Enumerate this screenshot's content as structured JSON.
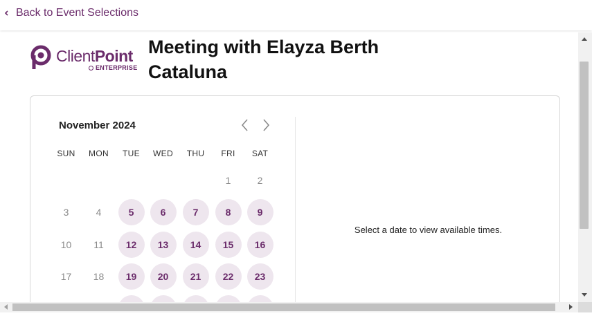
{
  "header": {
    "back_label": "Back to Event Selections"
  },
  "logo": {
    "brand_light": "Client",
    "brand_bold": "Point",
    "sub": "ENTERPRISE"
  },
  "event": {
    "title": "Meeting with Elayza Berth Cataluna"
  },
  "calendar": {
    "month_label": "November 2024",
    "weekdays": [
      "SUN",
      "MON",
      "TUE",
      "WED",
      "THU",
      "FRI",
      "SAT"
    ],
    "weeks": [
      [
        null,
        null,
        null,
        null,
        null,
        {
          "d": "1",
          "available": false
        },
        {
          "d": "2",
          "available": false
        }
      ],
      [
        {
          "d": "3",
          "available": false
        },
        {
          "d": "4",
          "available": false
        },
        {
          "d": "5",
          "available": true
        },
        {
          "d": "6",
          "available": true
        },
        {
          "d": "7",
          "available": true
        },
        {
          "d": "8",
          "available": true
        },
        {
          "d": "9",
          "available": true
        }
      ],
      [
        {
          "d": "10",
          "available": false
        },
        {
          "d": "11",
          "available": false
        },
        {
          "d": "12",
          "available": true
        },
        {
          "d": "13",
          "available": true
        },
        {
          "d": "14",
          "available": true
        },
        {
          "d": "15",
          "available": true
        },
        {
          "d": "16",
          "available": true
        }
      ],
      [
        {
          "d": "17",
          "available": false
        },
        {
          "d": "18",
          "available": false
        },
        {
          "d": "19",
          "available": true
        },
        {
          "d": "20",
          "available": true
        },
        {
          "d": "21",
          "available": true
        },
        {
          "d": "22",
          "available": true
        },
        {
          "d": "23",
          "available": true
        }
      ],
      [
        null,
        null,
        {
          "d": "",
          "available": true
        },
        {
          "d": "",
          "available": true
        },
        {
          "d": "",
          "available": true
        },
        {
          "d": "",
          "available": true
        },
        {
          "d": "",
          "available": true
        }
      ]
    ]
  },
  "times_panel": {
    "hint": "Select a date to view available times."
  },
  "colors": {
    "accent": "#6b2c6b",
    "available_bg": "#eee6ee",
    "disabled_text": "#8a8a8a"
  },
  "icons": {
    "back": "chevron-left-icon",
    "prev": "chevron-left-icon",
    "next": "chevron-right-icon"
  }
}
